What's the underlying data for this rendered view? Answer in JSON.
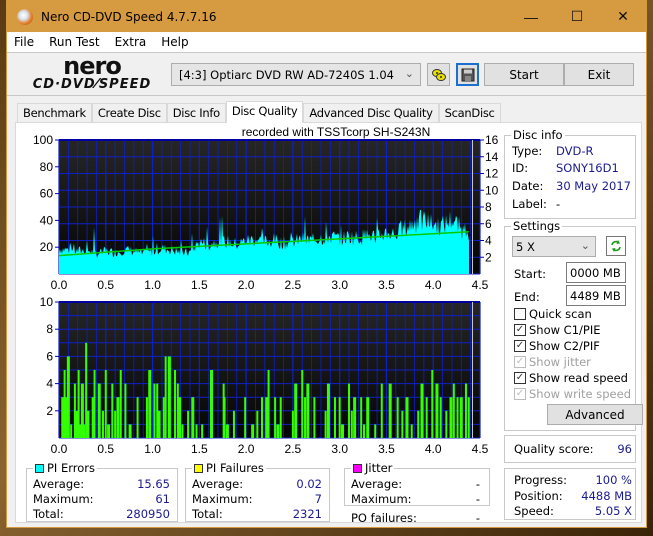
{
  "window": {
    "title": "Nero CD-DVD Speed 4.7.7.16",
    "controls": {
      "minimize": "—",
      "maximize": "☐",
      "close": "✕"
    }
  },
  "menu": [
    "File",
    "Run Test",
    "Extra",
    "Help"
  ],
  "toolbar": {
    "logo_top": "nero",
    "logo_bottom": "CD·DVD⁄SPEED",
    "drive": "[4:3]  Optiarc DVD RW AD-7240S 1.04",
    "start_label": "Start",
    "exit_label": "Exit",
    "icons": [
      "disc-change-icon",
      "save-icon"
    ]
  },
  "tabs": [
    {
      "label": "Benchmark",
      "active": false
    },
    {
      "label": "Create Disc",
      "active": false
    },
    {
      "label": "Disc Info",
      "active": false
    },
    {
      "label": "Disc Quality",
      "active": true
    },
    {
      "label": "Advanced Disc Quality",
      "active": false
    },
    {
      "label": "ScanDisc",
      "active": false
    }
  ],
  "chart_data": [
    {
      "type": "area",
      "title": "recorded with TSSTcorp SH-S243N",
      "xlabel": "",
      "ylabel": "PI Errors",
      "xlim": [
        0,
        4.5
      ],
      "ylim": [
        0,
        100
      ],
      "y2lim": [
        0,
        16
      ],
      "xticks": [
        "0.0",
        "0.5",
        "1.0",
        "1.5",
        "2.0",
        "2.5",
        "3.0",
        "3.5",
        "4.0",
        "4.5"
      ],
      "yticks": [
        "20",
        "40",
        "60",
        "80",
        "100"
      ],
      "y2ticks": [
        "2",
        "4",
        "6",
        "8",
        "10",
        "12",
        "14",
        "16"
      ],
      "grid": true,
      "series": [
        {
          "name": "PI Errors",
          "color": "#00ffff",
          "x": [
            0.0,
            0.1,
            0.2,
            0.3,
            0.4,
            0.5,
            0.6,
            0.7,
            0.8,
            0.9,
            1.0,
            1.1,
            1.2,
            1.3,
            1.4,
            1.5,
            1.6,
            1.7,
            1.8,
            1.9,
            2.0,
            2.1,
            2.2,
            2.3,
            2.4,
            2.5,
            2.6,
            2.7,
            2.8,
            2.9,
            3.0,
            3.1,
            3.2,
            3.3,
            3.4,
            3.5,
            3.6,
            3.7,
            3.8,
            3.9,
            4.0,
            4.1,
            4.2,
            4.3,
            4.38
          ],
          "values": [
            19,
            18,
            17,
            18,
            15,
            17,
            16,
            18,
            17,
            15,
            17,
            19,
            18,
            16,
            16,
            24,
            22,
            25,
            24,
            22,
            25,
            26,
            24,
            25,
            23,
            24,
            26,
            25,
            27,
            28,
            26,
            28,
            27,
            29,
            28,
            31,
            30,
            34,
            38,
            40,
            37,
            36,
            41,
            33,
            31
          ]
        },
        {
          "name": "Read speed (X)",
          "color": "#00cc00",
          "axis": "right",
          "x": [
            0.0,
            0.5,
            1.0,
            1.5,
            2.0,
            2.5,
            3.0,
            3.5,
            4.0,
            4.38
          ],
          "values": [
            2.2,
            2.6,
            3.0,
            3.3,
            3.6,
            3.9,
            4.2,
            4.5,
            4.8,
            5.05
          ]
        }
      ]
    },
    {
      "type": "bar",
      "ylabel": "PI Failures",
      "xlim": [
        0,
        4.5
      ],
      "ylim": [
        0,
        10
      ],
      "xticks": [
        "0.0",
        "0.5",
        "1.0",
        "1.5",
        "2.0",
        "2.5",
        "3.0",
        "3.5",
        "4.0",
        "4.5"
      ],
      "yticks": [
        "2",
        "4",
        "6",
        "8",
        "10"
      ],
      "grid": true,
      "series": [
        {
          "name": "PI Failures",
          "color": "#33ff00",
          "x": [
            0.04,
            0.06,
            0.08,
            0.1,
            0.13,
            0.17,
            0.19,
            0.21,
            0.23,
            0.25,
            0.27,
            0.29,
            0.31,
            0.36,
            0.38,
            0.43,
            0.47,
            0.5,
            0.53,
            0.57,
            0.6,
            0.63,
            0.66,
            0.71,
            0.76,
            0.84,
            0.94,
            0.97,
            1.02,
            1.05,
            1.07,
            1.12,
            1.14,
            1.18,
            1.24,
            1.27,
            1.29,
            1.32,
            1.38,
            1.43,
            1.47,
            1.53,
            1.63,
            1.76,
            1.77,
            1.8,
            1.87,
            1.99,
            2.07,
            2.12,
            2.17,
            2.22,
            2.24,
            2.31,
            2.34,
            2.37,
            2.5,
            2.53,
            2.6,
            2.63,
            2.66,
            2.73,
            2.85,
            2.88,
            2.95,
            3.0,
            3.03,
            3.1,
            3.13,
            3.16,
            3.23,
            3.26,
            3.3,
            3.38,
            3.45,
            3.54,
            3.62,
            3.67,
            3.72,
            3.77,
            3.84,
            3.88,
            3.93,
            3.99,
            4.04,
            4.08,
            4.14,
            4.19,
            4.22,
            4.26,
            4.3,
            4.35,
            4.38
          ],
          "values": [
            3,
            5,
            3,
            6,
            1,
            4,
            2,
            5,
            1,
            4,
            1,
            7,
            2,
            3,
            5,
            4,
            2,
            5,
            1,
            4,
            2,
            3,
            5,
            4,
            1,
            3,
            3,
            5,
            4,
            4,
            2,
            3,
            6,
            6,
            5,
            4,
            3,
            1,
            2,
            3,
            1,
            1,
            5,
            4,
            3,
            1,
            2,
            3,
            1,
            2,
            3,
            3,
            5,
            3,
            1,
            3,
            2,
            4,
            5,
            3,
            4,
            3,
            2,
            4,
            3,
            3,
            1,
            4,
            2,
            3,
            3,
            1,
            3,
            1,
            4,
            4,
            3,
            2,
            3,
            1,
            2,
            4,
            3,
            5,
            4,
            3,
            2,
            3,
            4,
            3,
            3,
            4,
            3
          ]
        }
      ]
    }
  ],
  "disc_info": {
    "title": "Disc info",
    "rows": [
      {
        "label": "Type:",
        "value": "DVD-R"
      },
      {
        "label": "ID:",
        "value": "SONY16D1"
      },
      {
        "label": "Date:",
        "value": "30 May 2017"
      },
      {
        "label": "Label:",
        "value": "-"
      }
    ]
  },
  "settings": {
    "title": "Settings",
    "speed": "5 X",
    "start_label": "Start:",
    "start_value": "0000 MB",
    "end_label": "End:",
    "end_value": "4489 MB",
    "checkboxes": [
      {
        "label": "Quick scan",
        "checked": false,
        "enabled": true
      },
      {
        "label": "Show C1/PIE",
        "checked": true,
        "enabled": true
      },
      {
        "label": "Show C2/PIF",
        "checked": true,
        "enabled": true
      },
      {
        "label": "Show jitter",
        "checked": true,
        "enabled": false
      },
      {
        "label": "Show read speed",
        "checked": true,
        "enabled": true
      },
      {
        "label": "Show write speed",
        "checked": true,
        "enabled": false
      }
    ],
    "advanced_label": "Advanced"
  },
  "quality": {
    "label": "Quality score:",
    "value": "96"
  },
  "progress": {
    "rows": [
      {
        "label": "Progress:",
        "value": "100 %"
      },
      {
        "label": "Position:",
        "value": "4488 MB"
      },
      {
        "label": "Speed:",
        "value": "5.05 X"
      }
    ]
  },
  "pi_errors": {
    "title": "PI Errors",
    "color": "#00ffff",
    "rows": [
      {
        "label": "Average:",
        "value": "15.65"
      },
      {
        "label": "Maximum:",
        "value": "61"
      },
      {
        "label": "Total:",
        "value": "280950"
      }
    ]
  },
  "pi_failures": {
    "title": "PI Failures",
    "color": "#ffff00",
    "rows": [
      {
        "label": "Average:",
        "value": "0.02"
      },
      {
        "label": "Maximum:",
        "value": "7"
      },
      {
        "label": "Total:",
        "value": "2321"
      }
    ]
  },
  "jitter": {
    "title": "Jitter",
    "color": "#ff00ff",
    "rows": [
      {
        "label": "Average:",
        "value": "-"
      },
      {
        "label": "Maximum:",
        "value": "-"
      }
    ]
  },
  "po_failures": {
    "label": "PO failures:",
    "value": "-"
  }
}
